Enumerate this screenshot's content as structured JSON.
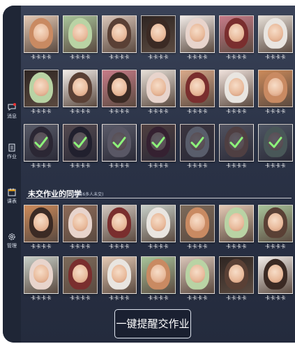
{
  "sidebar": {
    "items": [
      {
        "label": "消息",
        "icon": "message-icon"
      },
      {
        "label": "作业",
        "icon": "homework-icon"
      },
      {
        "label": "课表",
        "icon": "calendar-icon"
      },
      {
        "label": "管理",
        "icon": "gear-icon"
      }
    ]
  },
  "student_name_placeholder": "卡卡卡卡",
  "section": {
    "title": "未交作业的同学",
    "subtitle": "(还有6多人未交)"
  },
  "remind_button": {
    "label": "一键提醒交作业"
  },
  "photo_palette": [
    "#c98a62",
    "#b9d3a4",
    "#5a4035",
    "#3b2a24",
    "#e8d4cc",
    "#7a2e2e",
    "#e9e5e0"
  ]
}
